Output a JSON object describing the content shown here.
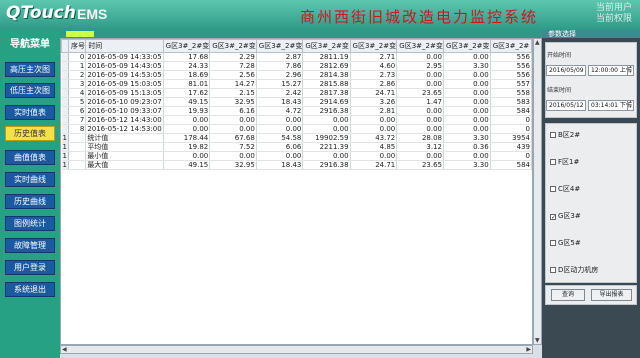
{
  "header": {
    "logo": "QTouch",
    "product": "EMS",
    "title": "商州西街旧城改造电力监控系统",
    "user_line1": "当前用户",
    "user_line2": "当前权限"
  },
  "sidebar": {
    "title": "导航菜单",
    "items": [
      {
        "label": "高压主次图"
      },
      {
        "label": "低压主次图"
      },
      {
        "label": "实时值表"
      },
      {
        "label": "历史值表"
      },
      {
        "label": "曲值值表"
      },
      {
        "label": "实时曲线"
      },
      {
        "label": "历史曲线"
      },
      {
        "label": "图例统计"
      },
      {
        "label": "故障管理"
      },
      {
        "label": "用户登录"
      },
      {
        "label": "系统退出"
      }
    ],
    "active_index": 3
  },
  "table": {
    "columns": [
      "序号",
      "时间",
      "G区3#_2#变",
      "G区3#_2#变",
      "G区3#_2#变",
      "G区3#_2#变",
      "G区3#_2#变",
      "G区3#_2#变",
      "G区3#_2#变",
      "G区3#_2#"
    ],
    "rows": [
      [
        "0",
        "2016-05-09 14:33:05",
        "17.68",
        "2.29",
        "2.87",
        "2811.19",
        "2.71",
        "0.00",
        "0.00",
        "556"
      ],
      [
        "1",
        "2016-05-09 14:43:05",
        "24.33",
        "7.28",
        "7.86",
        "2812.69",
        "4.60",
        "2.95",
        "3.30",
        "556"
      ],
      [
        "2",
        "2016-05-09 14:53:05",
        "18.69",
        "2.56",
        "2.96",
        "2814.38",
        "2.73",
        "0.00",
        "0.00",
        "556"
      ],
      [
        "3",
        "2016-05-09 15:03:05",
        "81.01",
        "14.27",
        "15.27",
        "2815.88",
        "2.86",
        "0.00",
        "0.00",
        "557"
      ],
      [
        "4",
        "2016-05-09 15:13:05",
        "17.62",
        "2.15",
        "2.42",
        "2817.38",
        "24.71",
        "23.65",
        "0.00",
        "558"
      ],
      [
        "5",
        "2016-05-10 09:23:07",
        "49.15",
        "32.95",
        "18.43",
        "2914.69",
        "3.26",
        "1.47",
        "0.00",
        "583"
      ],
      [
        "6",
        "2016-05-10 09:33:07",
        "19.93",
        "6.16",
        "4.72",
        "2916.38",
        "2.81",
        "0.00",
        "0.00",
        "584"
      ],
      [
        "7",
        "2016-05-12 14:43:00",
        "0.00",
        "0.00",
        "0.00",
        "0.00",
        "0.00",
        "0.00",
        "0.00",
        "0"
      ],
      [
        "8",
        "2016-05-12 14:53:00",
        "0.00",
        "0.00",
        "0.00",
        "0.00",
        "0.00",
        "0.00",
        "0.00",
        "0"
      ],
      [
        "",
        "统计值",
        "178.44",
        "67.68",
        "54.58",
        "19902.59",
        "43.72",
        "28.08",
        "3.30",
        "3954"
      ],
      [
        "",
        "平均值",
        "19.82",
        "7.52",
        "6.06",
        "2211.39",
        "4.85",
        "3.12",
        "0.36",
        "439"
      ],
      [
        "",
        "最小值",
        "0.00",
        "0.00",
        "0.00",
        "0.00",
        "0.00",
        "0.00",
        "0.00",
        "0"
      ],
      [
        "",
        "最大值",
        "49.15",
        "32.95",
        "18.43",
        "2916.38",
        "24.71",
        "23.65",
        "3.30",
        "584"
      ]
    ],
    "row_marks": [
      "",
      "",
      "",
      "",
      "",
      "",
      "",
      "",
      "",
      "1",
      "1",
      "1",
      "1"
    ]
  },
  "panel": {
    "header": "参数选择",
    "start_label": "开始时间",
    "start_date": "2016/05/09",
    "start_time": "12:00:00 上午",
    "end_label": "结束时间",
    "end_date": "2016/05/12",
    "end_time": "03:14:01 下午",
    "options": [
      {
        "label": "B区2#",
        "checked": false
      },
      {
        "label": "F区1#",
        "checked": false
      },
      {
        "label": "C区4#",
        "checked": false
      },
      {
        "label": "G区3#",
        "checked": true
      },
      {
        "label": "G区5#",
        "checked": false
      },
      {
        "label": "D区动力机房",
        "checked": false
      }
    ],
    "query_button": "查询",
    "export_button": "导出报表"
  },
  "colors": {
    "header_bg": "#2e9a86",
    "title_red": "#c8181e",
    "nav_btn": "#1b5aa0",
    "nav_active": "#f5e04a"
  }
}
